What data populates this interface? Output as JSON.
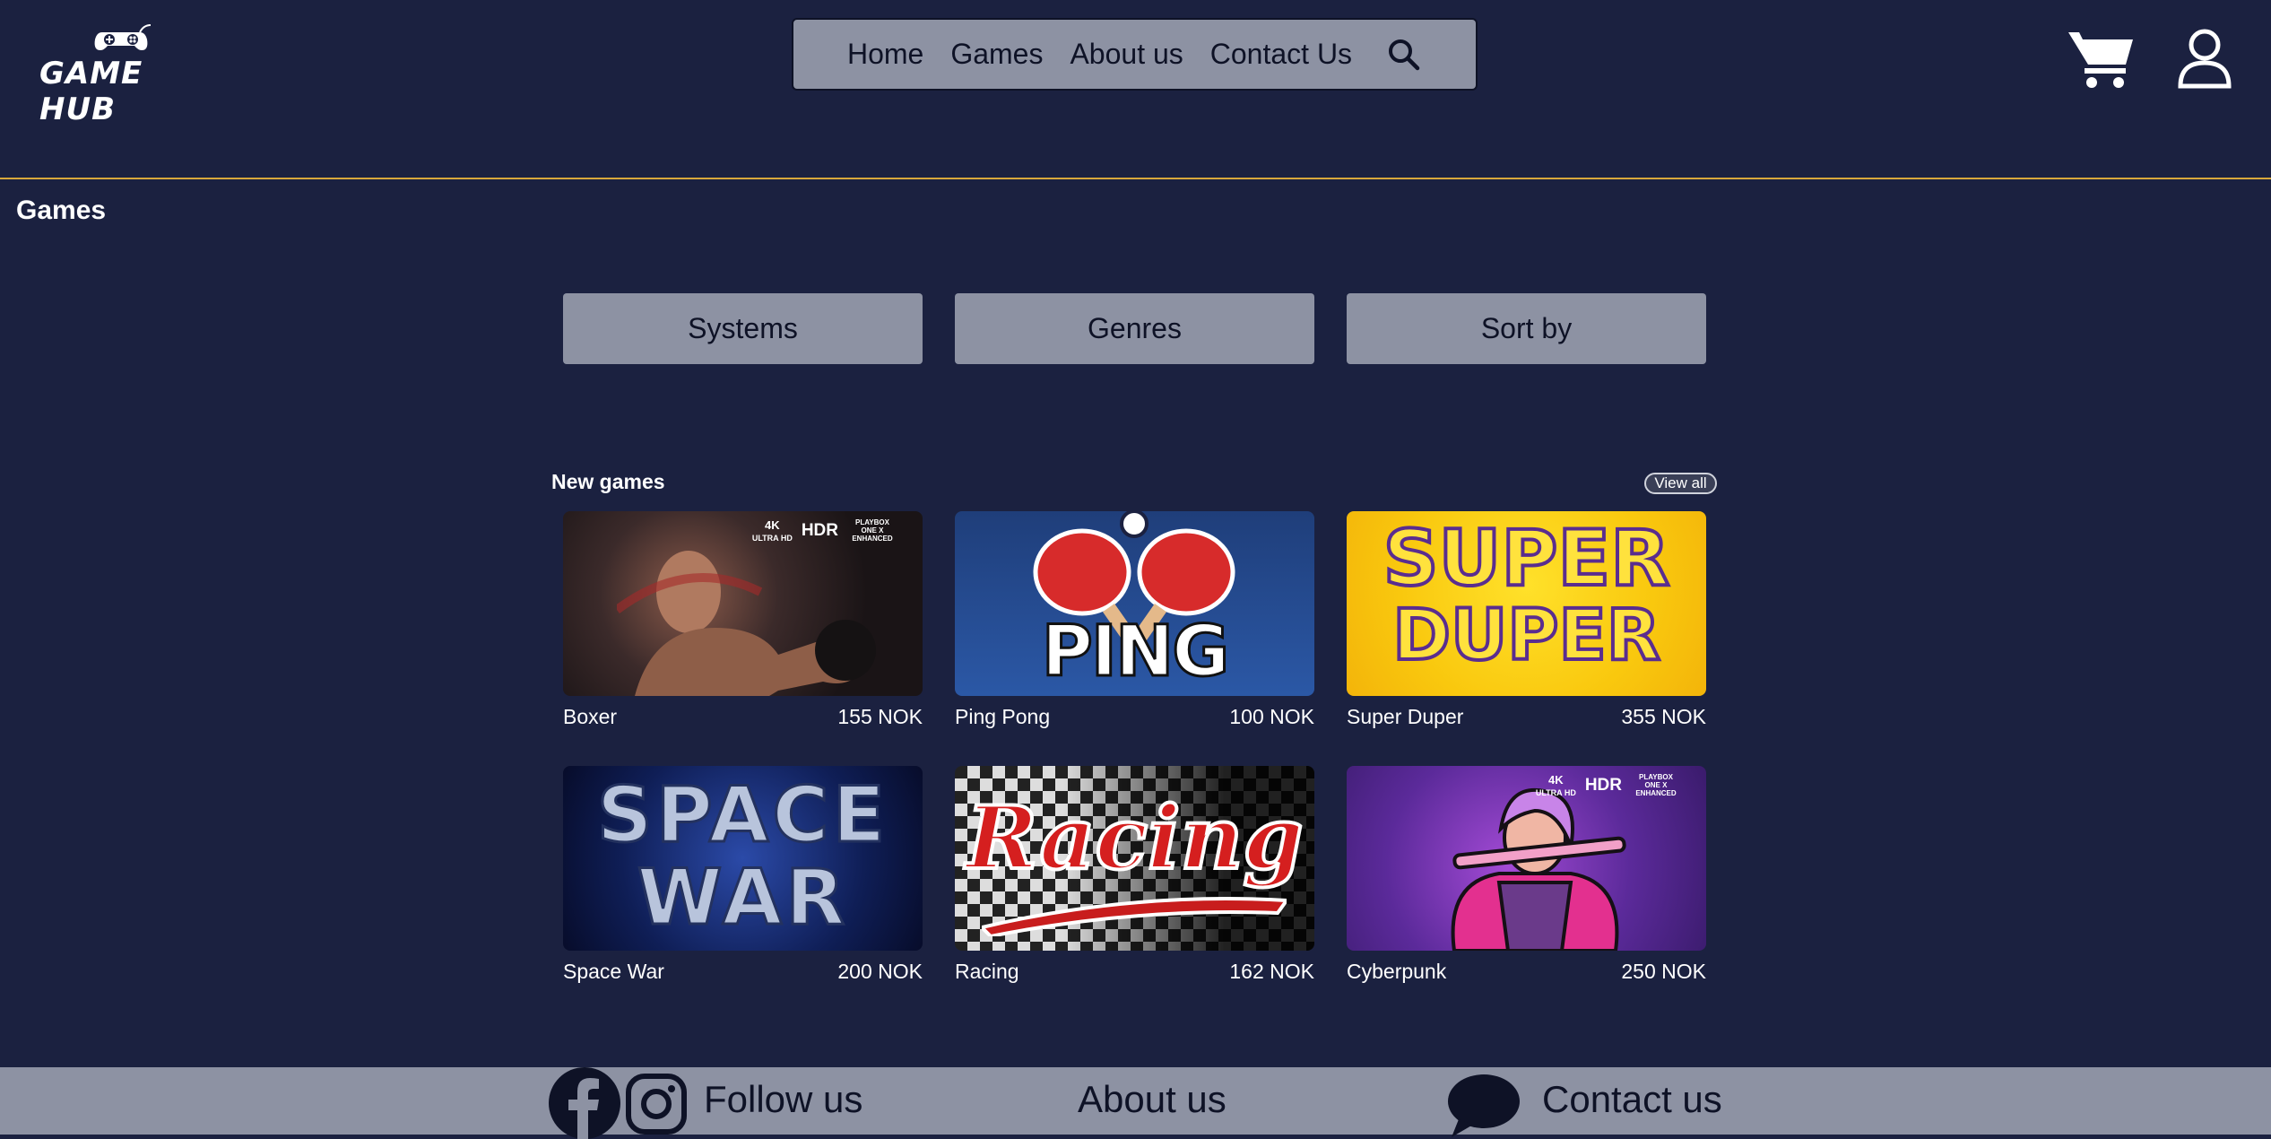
{
  "brand": {
    "logo_text": "GAME HUB"
  },
  "nav": {
    "items": [
      "Home",
      "Games",
      "About us",
      "Contact Us"
    ]
  },
  "header": {
    "accent_color": "#d8a73b"
  },
  "page": {
    "title": "Games"
  },
  "filters": [
    "Systems",
    "Genres",
    "Sort by"
  ],
  "section": {
    "title": "New games",
    "view_all": "View all"
  },
  "games": [
    {
      "name": "Boxer",
      "price": "155 NOK",
      "badge_4k": "4K",
      "badge_uhd": "ULTRA HD",
      "badge_hdr": "HDR",
      "badge_xbox": "PLAYBOX ONE X ENHANCED"
    },
    {
      "name": "Ping Pong",
      "price": "100 NOK",
      "art_text": "PING PONG"
    },
    {
      "name": "Super Duper",
      "price": "355 NOK",
      "art_text_1": "SUPER",
      "art_text_2": "DUPER"
    },
    {
      "name": "Space War",
      "price": "200 NOK",
      "art_text_1": "SPACE",
      "art_text_2": "WAR"
    },
    {
      "name": "Racing",
      "price": "162 NOK",
      "art_text": "Racing"
    },
    {
      "name": "Cyberpunk",
      "price": "250 NOK",
      "badge_4k": "4K",
      "badge_uhd": "ULTRA HD",
      "badge_hdr": "HDR",
      "badge_xbox": "PLAYBOX ONE X ENHANCED"
    }
  ],
  "footer": {
    "follow": "Follow us",
    "about": "About us",
    "contact": "Contact us"
  },
  "icons": [
    "gamepad-icon",
    "search-icon",
    "cart-icon",
    "user-icon",
    "facebook-icon",
    "instagram-icon",
    "chat-bubble-icon"
  ]
}
